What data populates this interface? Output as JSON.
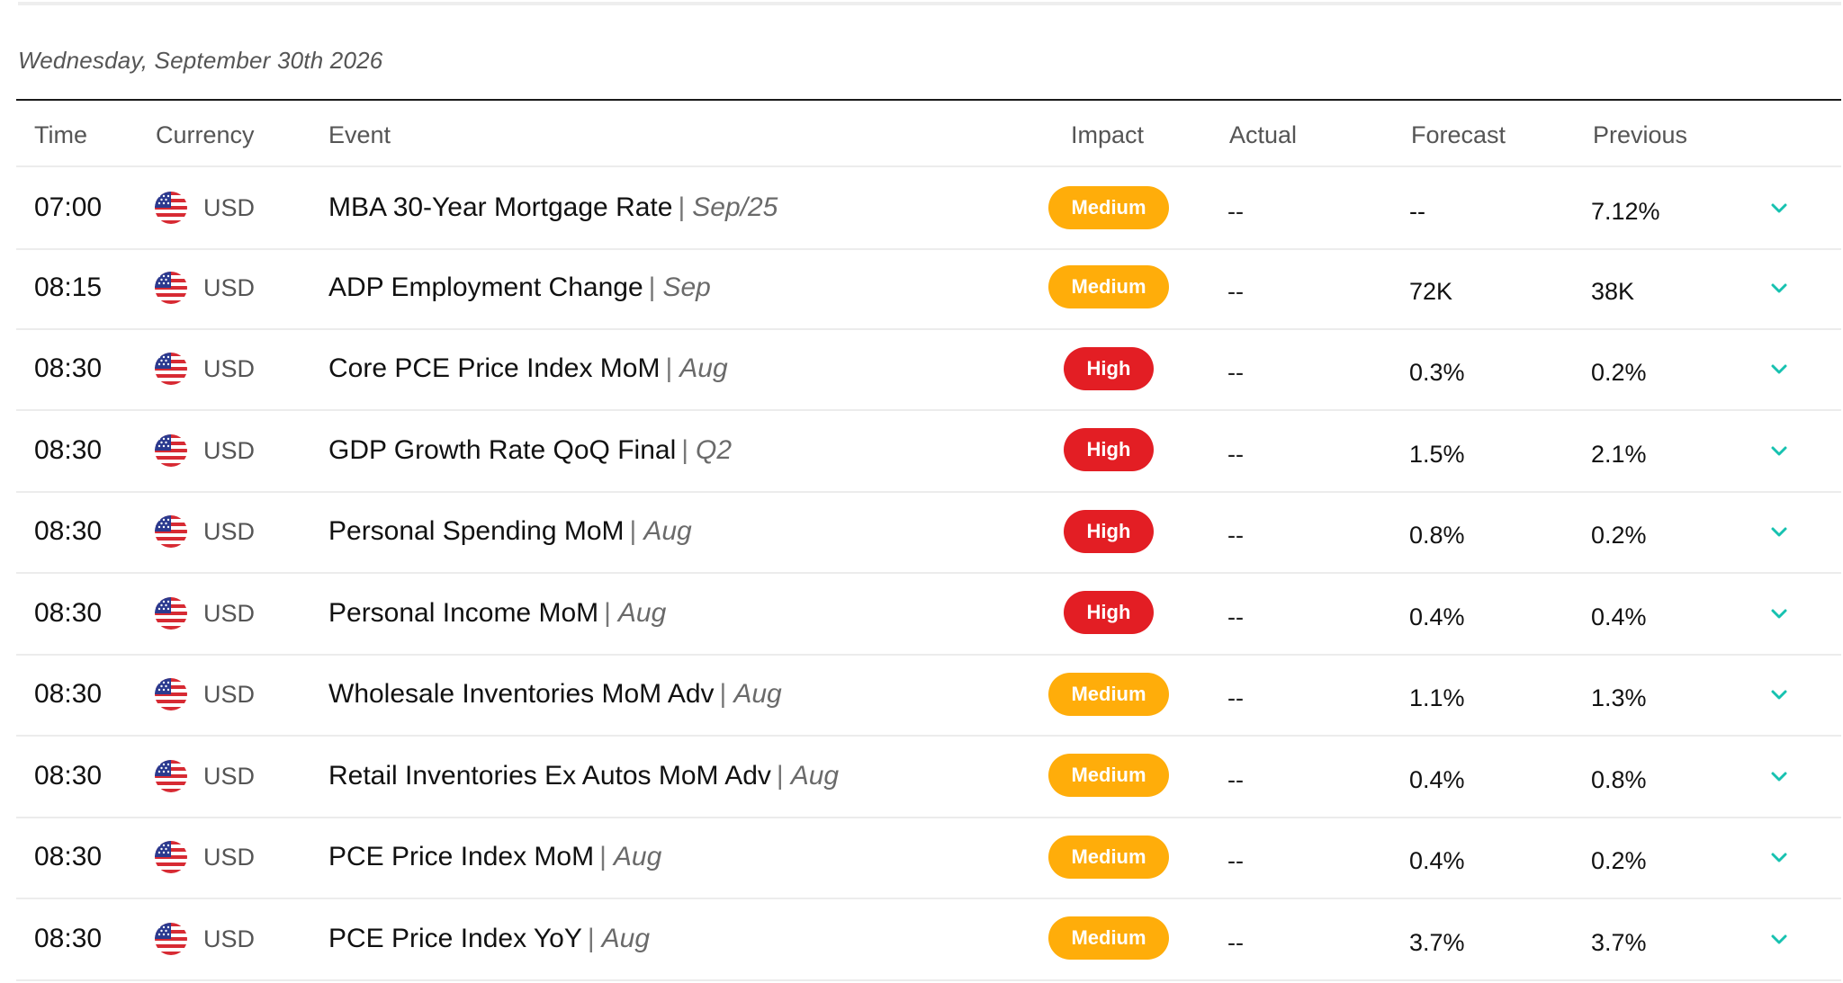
{
  "calendar": {
    "date_heading": "Wednesday, September 30th 2026",
    "columns": {
      "time": "Time",
      "currency": "Currency",
      "event": "Event",
      "impact": "Impact",
      "actual": "Actual",
      "forecast": "Forecast",
      "previous": "Previous"
    },
    "colors": {
      "impact_medium": "#ffad0a",
      "impact_high": "#e31e24",
      "chevron": "#17c2b0"
    },
    "rows": [
      {
        "time": "07:00",
        "flag_icon": "us-flag-icon",
        "currency": "USD",
        "event": "MBA 30-Year Mortgage Rate",
        "separator": "|",
        "period": "Sep/25",
        "impact": "Medium",
        "impact_level": "medium",
        "actual": "--",
        "forecast": "--",
        "previous": "7.12%"
      },
      {
        "time": "08:15",
        "flag_icon": "us-flag-icon",
        "currency": "USD",
        "event": "ADP Employment Change",
        "separator": "|",
        "period": "Sep",
        "impact": "Medium",
        "impact_level": "medium",
        "actual": "--",
        "forecast": "72K",
        "previous": "38K"
      },
      {
        "time": "08:30",
        "flag_icon": "us-flag-icon",
        "currency": "USD",
        "event": "Core PCE Price Index MoM",
        "separator": "|",
        "period": "Aug",
        "impact": "High",
        "impact_level": "high",
        "actual": "--",
        "forecast": "0.3%",
        "previous": "0.2%"
      },
      {
        "time": "08:30",
        "flag_icon": "us-flag-icon",
        "currency": "USD",
        "event": "GDP Growth Rate QoQ Final",
        "separator": "|",
        "period": "Q2",
        "impact": "High",
        "impact_level": "high",
        "actual": "--",
        "forecast": "1.5%",
        "previous": "2.1%"
      },
      {
        "time": "08:30",
        "flag_icon": "us-flag-icon",
        "currency": "USD",
        "event": "Personal Spending MoM",
        "separator": "|",
        "period": "Aug",
        "impact": "High",
        "impact_level": "high",
        "actual": "--",
        "forecast": "0.8%",
        "previous": "0.2%"
      },
      {
        "time": "08:30",
        "flag_icon": "us-flag-icon",
        "currency": "USD",
        "event": "Personal Income MoM",
        "separator": "|",
        "period": "Aug",
        "impact": "High",
        "impact_level": "high",
        "actual": "--",
        "forecast": "0.4%",
        "previous": "0.4%"
      },
      {
        "time": "08:30",
        "flag_icon": "us-flag-icon",
        "currency": "USD",
        "event": "Wholesale Inventories MoM Adv",
        "separator": "|",
        "period": "Aug",
        "impact": "Medium",
        "impact_level": "medium",
        "actual": "--",
        "forecast": "1.1%",
        "previous": "1.3%"
      },
      {
        "time": "08:30",
        "flag_icon": "us-flag-icon",
        "currency": "USD",
        "event": "Retail Inventories Ex Autos MoM Adv",
        "separator": "|",
        "period": "Aug",
        "impact": "Medium",
        "impact_level": "medium",
        "actual": "--",
        "forecast": "0.4%",
        "previous": "0.8%"
      },
      {
        "time": "08:30",
        "flag_icon": "us-flag-icon",
        "currency": "USD",
        "event": "PCE Price Index MoM",
        "separator": "|",
        "period": "Aug",
        "impact": "Medium",
        "impact_level": "medium",
        "actual": "--",
        "forecast": "0.4%",
        "previous": "0.2%"
      },
      {
        "time": "08:30",
        "flag_icon": "us-flag-icon",
        "currency": "USD",
        "event": "PCE Price Index YoY",
        "separator": "|",
        "period": "Aug",
        "impact": "Medium",
        "impact_level": "medium",
        "actual": "--",
        "forecast": "3.7%",
        "previous": "3.7%"
      }
    ]
  }
}
